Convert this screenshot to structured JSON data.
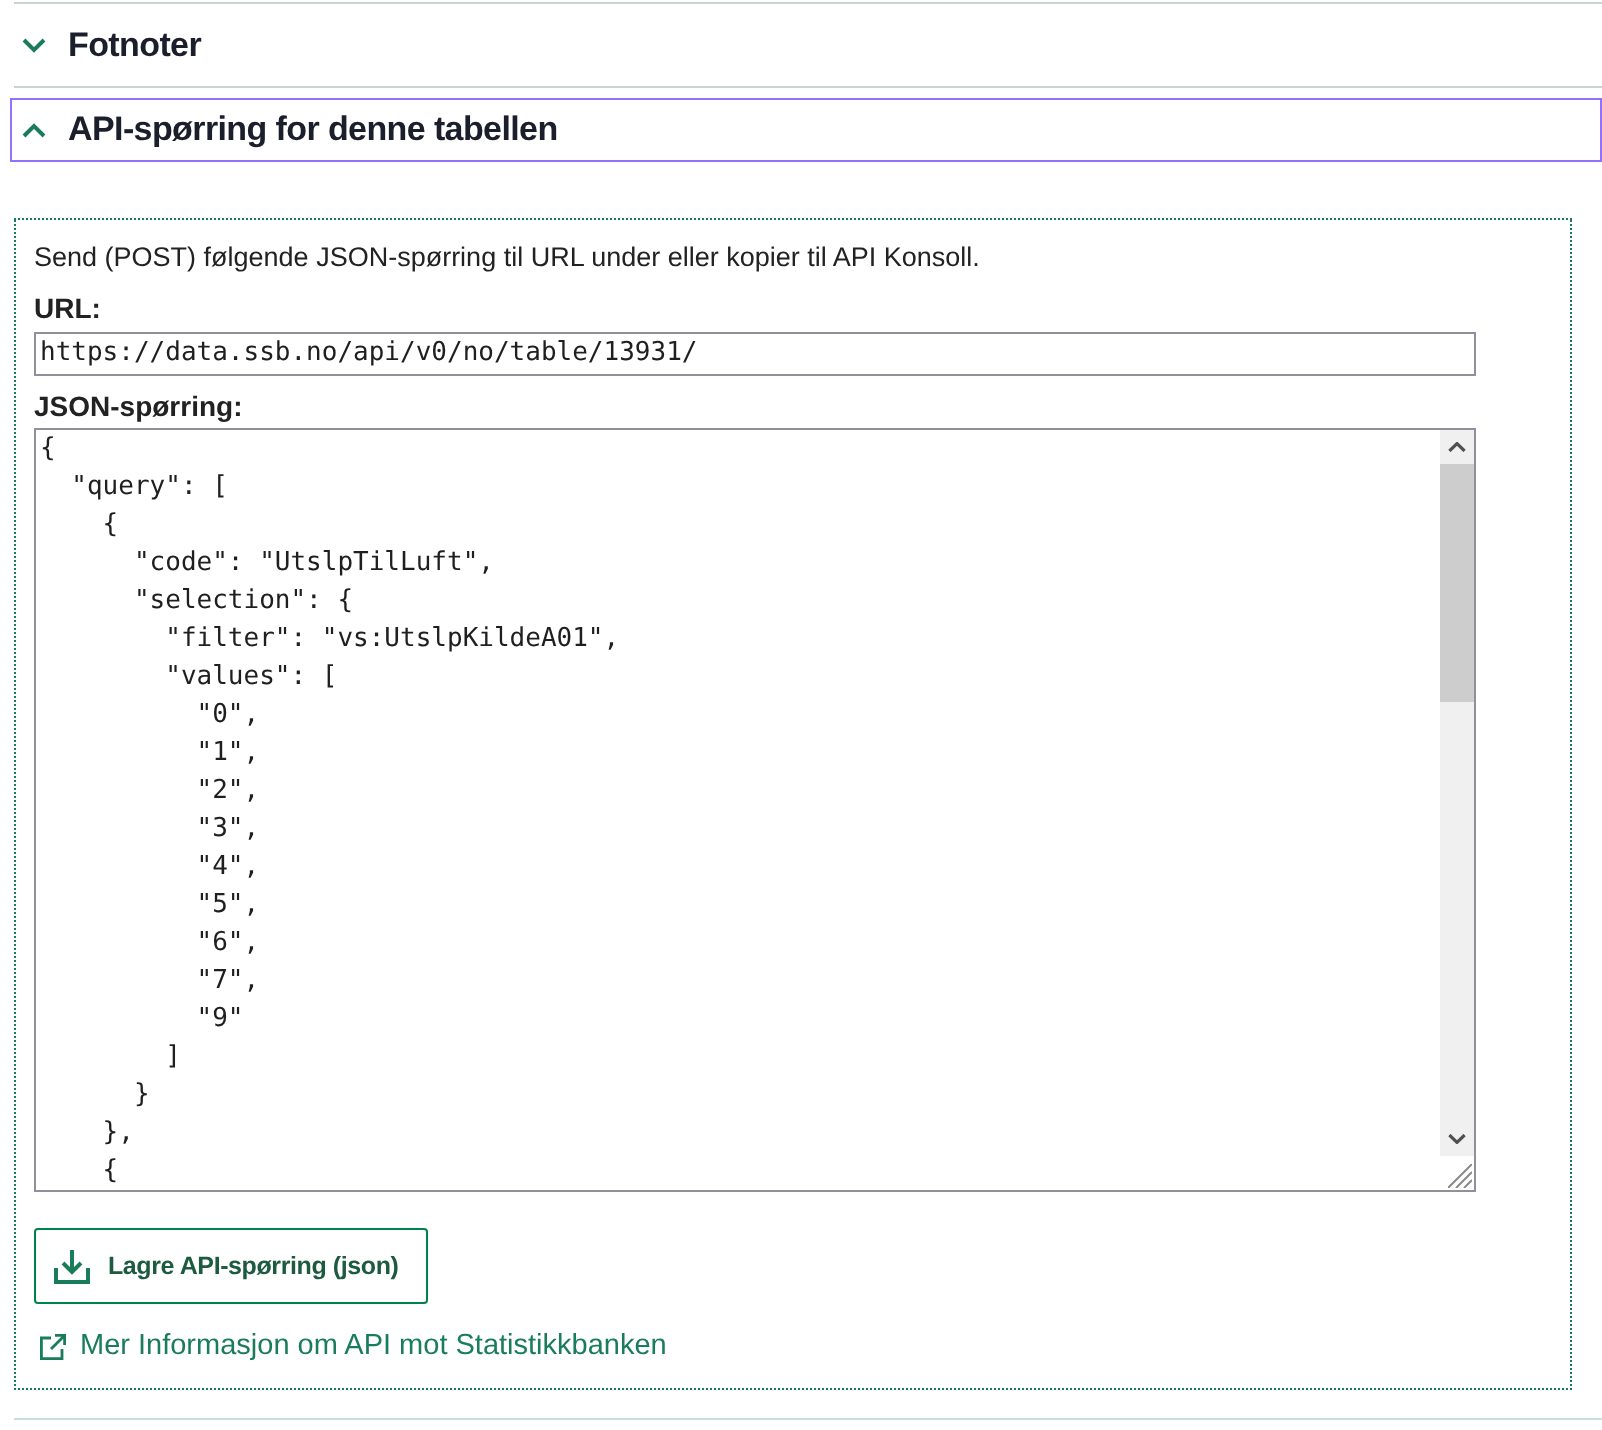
{
  "accordion": [
    {
      "title": "Fotnoter",
      "expanded": false,
      "focused": false
    },
    {
      "title": "API-spørring for denne tabellen",
      "expanded": true,
      "focused": true,
      "panel": {
        "description": "Send (POST) følgende JSON-spørring til URL under eller kopier til API Konsoll.",
        "url": {
          "label": "URL:",
          "value": "https://data.ssb.no/api/v0/no/table/13931/"
        },
        "json_query": {
          "label": "JSON-spørring:",
          "value": "{\n  \"query\": [\n    {\n      \"code\": \"UtslpTilLuft\",\n      \"selection\": {\n        \"filter\": \"vs:UtslpKildeA01\",\n        \"values\": [\n          \"0\",\n          \"1\",\n          \"2\",\n          \"3\",\n          \"4\",\n          \"5\",\n          \"6\",\n          \"7\",\n          \"9\"\n        ]\n      }\n    },\n    {"
        },
        "save_button": {
          "label": "Lagre API-spørring (json)"
        },
        "info_link": {
          "label": "Mer Informasjon om API mot Statistikkbanken"
        }
      }
    }
  ]
}
